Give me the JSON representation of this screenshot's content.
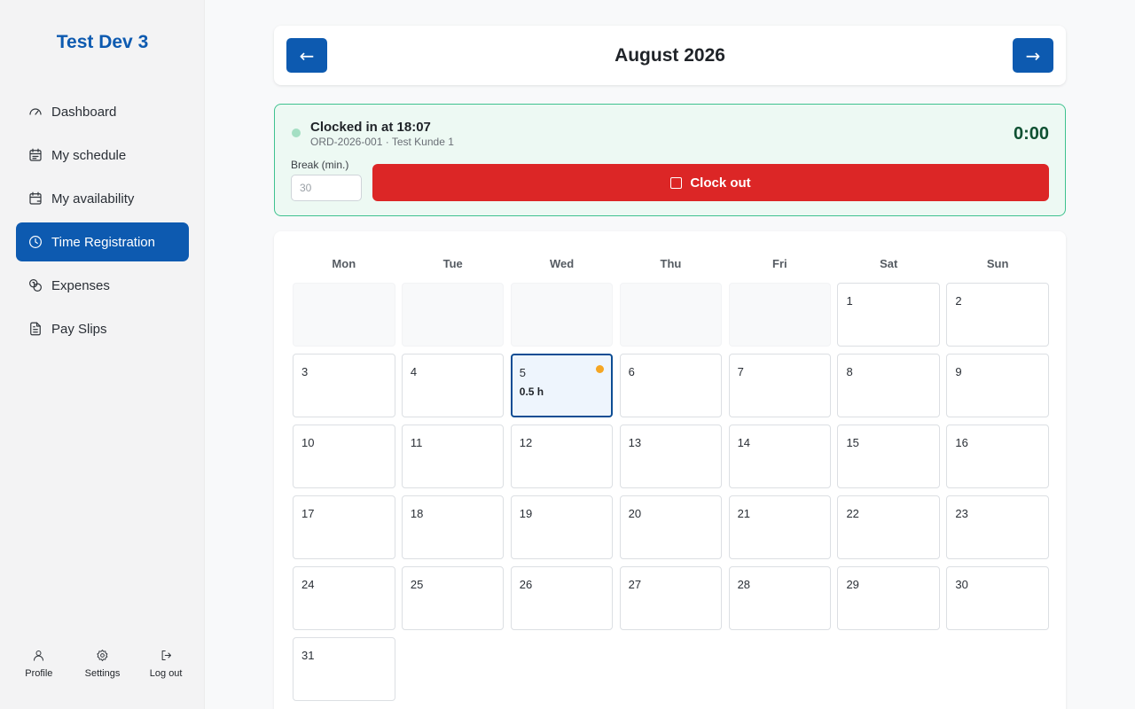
{
  "app": {
    "name": "Test Dev 3"
  },
  "sidebar": {
    "items": [
      {
        "label": "Dashboard",
        "icon": "gauge-icon",
        "active": false
      },
      {
        "label": "My schedule",
        "icon": "calendar-list-icon",
        "active": false
      },
      {
        "label": "My availability",
        "icon": "calendar-check-icon",
        "active": false
      },
      {
        "label": "Time Registration",
        "icon": "clock-icon",
        "active": true
      },
      {
        "label": "Expenses",
        "icon": "coins-icon",
        "active": false
      },
      {
        "label": "Pay Slips",
        "icon": "document-icon",
        "active": false
      }
    ],
    "footer": [
      {
        "label": "Profile",
        "icon": "user-icon"
      },
      {
        "label": "Settings",
        "icon": "gear-icon"
      },
      {
        "label": "Log out",
        "icon": "logout-icon"
      }
    ]
  },
  "month_nav": {
    "prev_label": "←",
    "next_label": "→",
    "title": "August 2026"
  },
  "clock": {
    "title": "Clocked in at 18:07",
    "subtitle": "ORD-2026-001 · Test Kunde 1",
    "timer": "0:00",
    "break_label": "Break (min.)",
    "break_placeholder": "30",
    "clockout_label": "Clock out",
    "status_color": "#a4dfc3"
  },
  "calendar": {
    "weekdays": [
      "Mon",
      "Tue",
      "Wed",
      "Thu",
      "Fri",
      "Sat",
      "Sun"
    ],
    "leading_blanks": 5,
    "days": [
      {
        "day": "1"
      },
      {
        "day": "2"
      },
      {
        "day": "3"
      },
      {
        "day": "4"
      },
      {
        "day": "5",
        "hours": "0.5 h",
        "selected": true,
        "marker": true
      },
      {
        "day": "6"
      },
      {
        "day": "7"
      },
      {
        "day": "8"
      },
      {
        "day": "9"
      },
      {
        "day": "10"
      },
      {
        "day": "11"
      },
      {
        "day": "12"
      },
      {
        "day": "13"
      },
      {
        "day": "14"
      },
      {
        "day": "15"
      },
      {
        "day": "16"
      },
      {
        "day": "17"
      },
      {
        "day": "18"
      },
      {
        "day": "19"
      },
      {
        "day": "20"
      },
      {
        "day": "21"
      },
      {
        "day": "22"
      },
      {
        "day": "23"
      },
      {
        "day": "24"
      },
      {
        "day": "25"
      },
      {
        "day": "26"
      },
      {
        "day": "27"
      },
      {
        "day": "28"
      },
      {
        "day": "29"
      },
      {
        "day": "30"
      },
      {
        "day": "31"
      }
    ]
  },
  "colors": {
    "brand": "#0d5ab0",
    "danger": "#dc2626",
    "success_border": "#3fc28f",
    "marker": "#f5a623"
  }
}
